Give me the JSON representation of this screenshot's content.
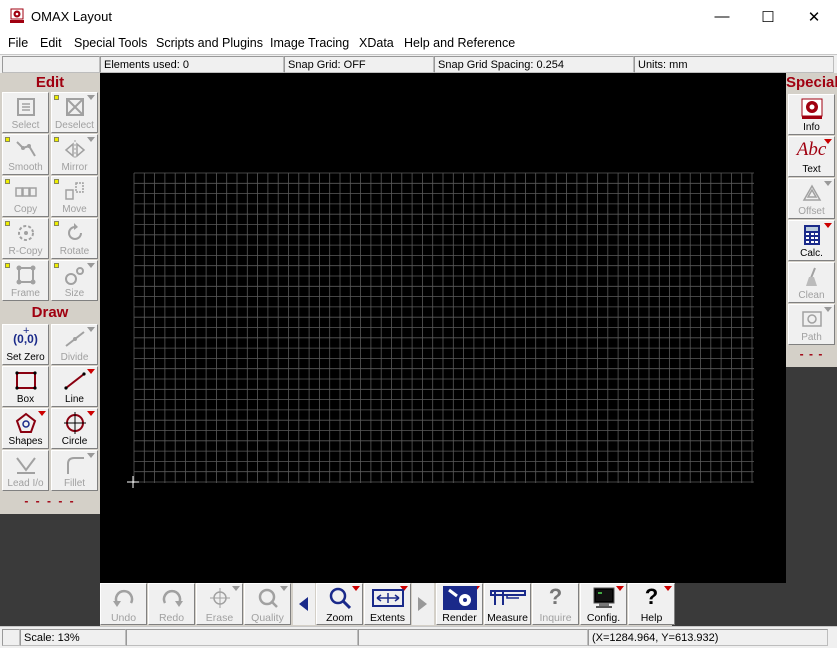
{
  "window": {
    "title": "OMAX Layout",
    "minimize": "—",
    "maximize": "☐",
    "close": "✕"
  },
  "menu": [
    "File",
    "Edit",
    "Special Tools",
    "Scripts and Plugins",
    "Image Tracing",
    "XData",
    "Help and Reference"
  ],
  "status": {
    "elements_used": "Elements used: 0",
    "snap_grid": "Snap Grid: OFF",
    "snap_spacing": "Snap Grid Spacing: 0.254",
    "units": "Units: mm"
  },
  "edit_panel": {
    "header": "Edit",
    "buttons": [
      "Select",
      "Deselect",
      "Smooth",
      "Mirror",
      "Copy",
      "Move",
      "R-Copy",
      "Rotate",
      "Frame",
      "Size"
    ]
  },
  "draw_panel": {
    "header": "Draw",
    "buttons": [
      "Set Zero",
      "Divide",
      "Box",
      "Line",
      "Shapes",
      "Circle",
      "Lead I/o",
      "Fillet"
    ],
    "footer": "- - - - -"
  },
  "special_panel": {
    "header": "Special",
    "buttons": [
      "Info",
      "Text",
      "Offset",
      "Calc.",
      "Clean",
      "Path"
    ],
    "footer": "- - -"
  },
  "set_zero_glyph": "(0,0)",
  "text_glyph": "Abc",
  "bottom_toolbar": [
    "Undo",
    "Redo",
    "Erase",
    "Quality",
    "Zoom",
    "Extents",
    "Render",
    "Measure",
    "Inquire",
    "Config.",
    "Help"
  ],
  "footer": {
    "scale": "Scale: 13%",
    "coords": "(X=1284.964, Y=613.932)"
  },
  "colors": {
    "accent": "#a00010",
    "canvas": "#000000",
    "grid": "#5a5a5a"
  }
}
